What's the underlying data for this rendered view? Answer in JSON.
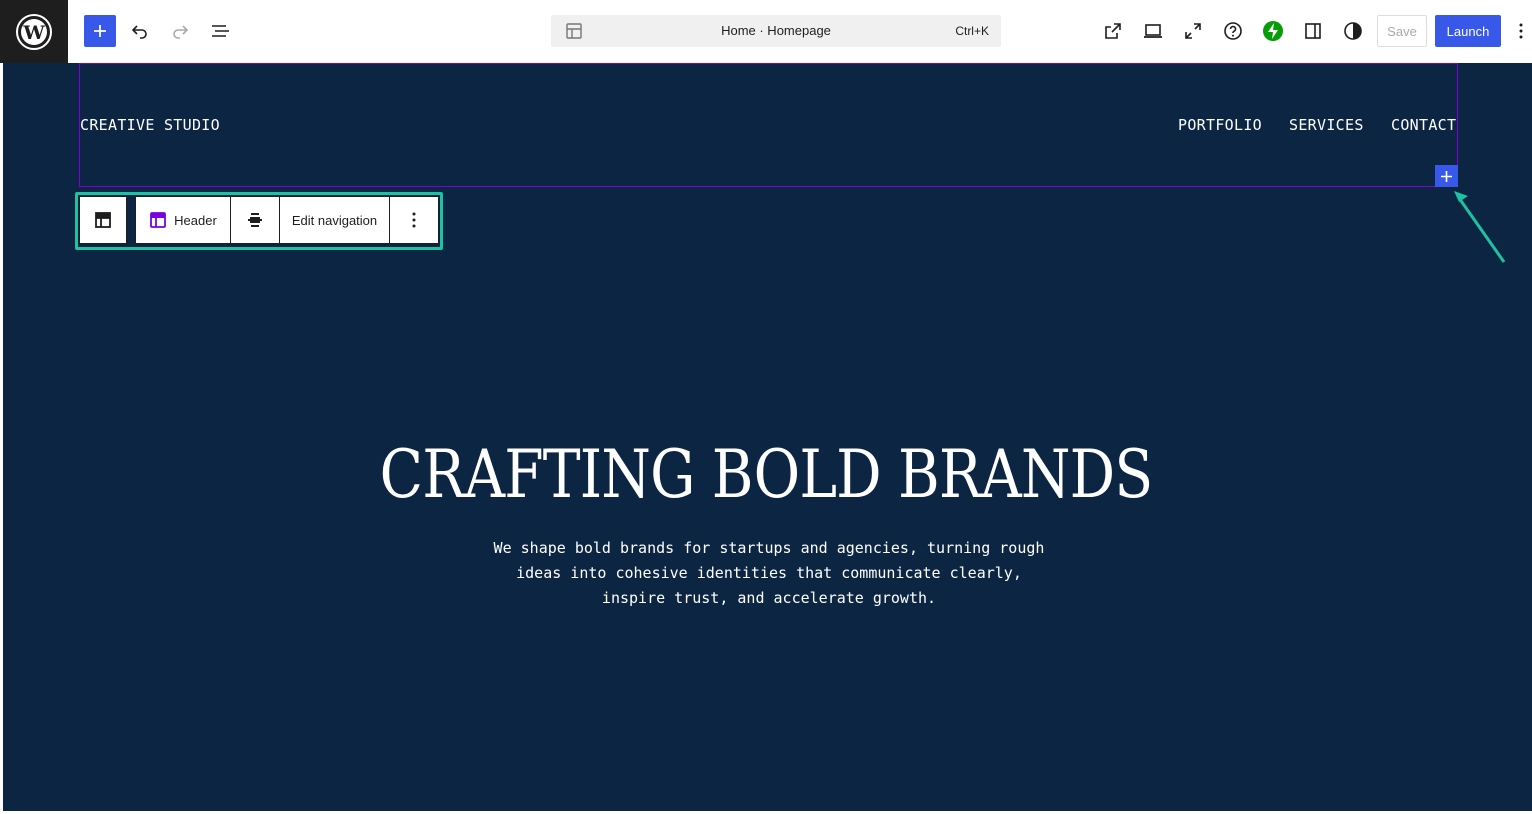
{
  "topbar": {
    "document_title": "Home · Homepage",
    "shortcut": "Ctrl+K",
    "save_label": "Save",
    "launch_label": "Launch",
    "accent_color": "#3858e9"
  },
  "site": {
    "title": "CREATIVE STUDIO",
    "nav": [
      "PORTFOLIO",
      "SERVICES",
      "CONTACT"
    ]
  },
  "block_toolbar": {
    "block_label": "Header",
    "edit_navigation_label": "Edit navigation"
  },
  "hero": {
    "title": "CRAFTING BOLD BRANDS",
    "text": "We shape bold brands for startups and agencies, turning rough ideas into cohesive identities that communicate clearly, inspire trust, and accelerate growth."
  },
  "colors": {
    "canvas_bg": "#0c2542",
    "selection_outline": "#7a00df",
    "highlight": "#1fc1a4"
  }
}
